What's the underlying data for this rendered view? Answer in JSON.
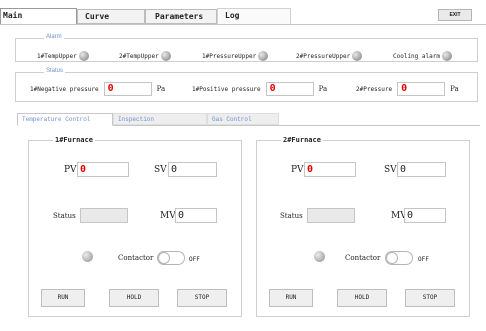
{
  "tabs": [
    {
      "label": "Main"
    },
    {
      "label": "Curve"
    },
    {
      "label": "Parameters"
    },
    {
      "label": "Log"
    }
  ],
  "exit_label": "EXIT",
  "alarm": {
    "legend": "Alarm",
    "items": [
      {
        "label": "1#TempUpper"
      },
      {
        "label": "2#TempUpper"
      },
      {
        "label": "1#PressureUpper"
      },
      {
        "label": "2#PressureUpper"
      },
      {
        "label": "Cooling alarm"
      }
    ]
  },
  "status": {
    "legend": "Status",
    "items": [
      {
        "label": "1#Negative pressure",
        "value": "0",
        "unit": "Pa"
      },
      {
        "label": "1#Positive pressure",
        "value": "0",
        "unit": "Pa"
      },
      {
        "label": "2#Pressure",
        "value": "0",
        "unit": "Pa"
      }
    ]
  },
  "subtabs": [
    {
      "label": "Temperature Control"
    },
    {
      "label": "Inspection"
    },
    {
      "label": "Gas Control"
    }
  ],
  "furnaces": [
    {
      "title": "1#Furnace",
      "pv_label": "PV",
      "pv_value": "0",
      "sv_label": "SV",
      "sv_value": "0",
      "status_label": "Status",
      "status_value": "",
      "mv_label": "MV",
      "mv_value": "0",
      "contactor_label": "Contactor",
      "toggle_state": "OFF",
      "run": "RUN",
      "hold": "HOLD",
      "stop": "STOP"
    },
    {
      "title": "2#Furnace",
      "pv_label": "PV",
      "pv_value": "0",
      "sv_label": "SV",
      "sv_value": "0",
      "status_label": "Status",
      "status_value": "",
      "mv_label": "MV",
      "mv_value": "0",
      "contactor_label": "Contactor",
      "toggle_state": "OFF",
      "run": "RUN",
      "hold": "HOLD",
      "stop": "STOP"
    }
  ],
  "colors": {
    "accent": "#6f8fd0",
    "value_red": "#e30000"
  }
}
